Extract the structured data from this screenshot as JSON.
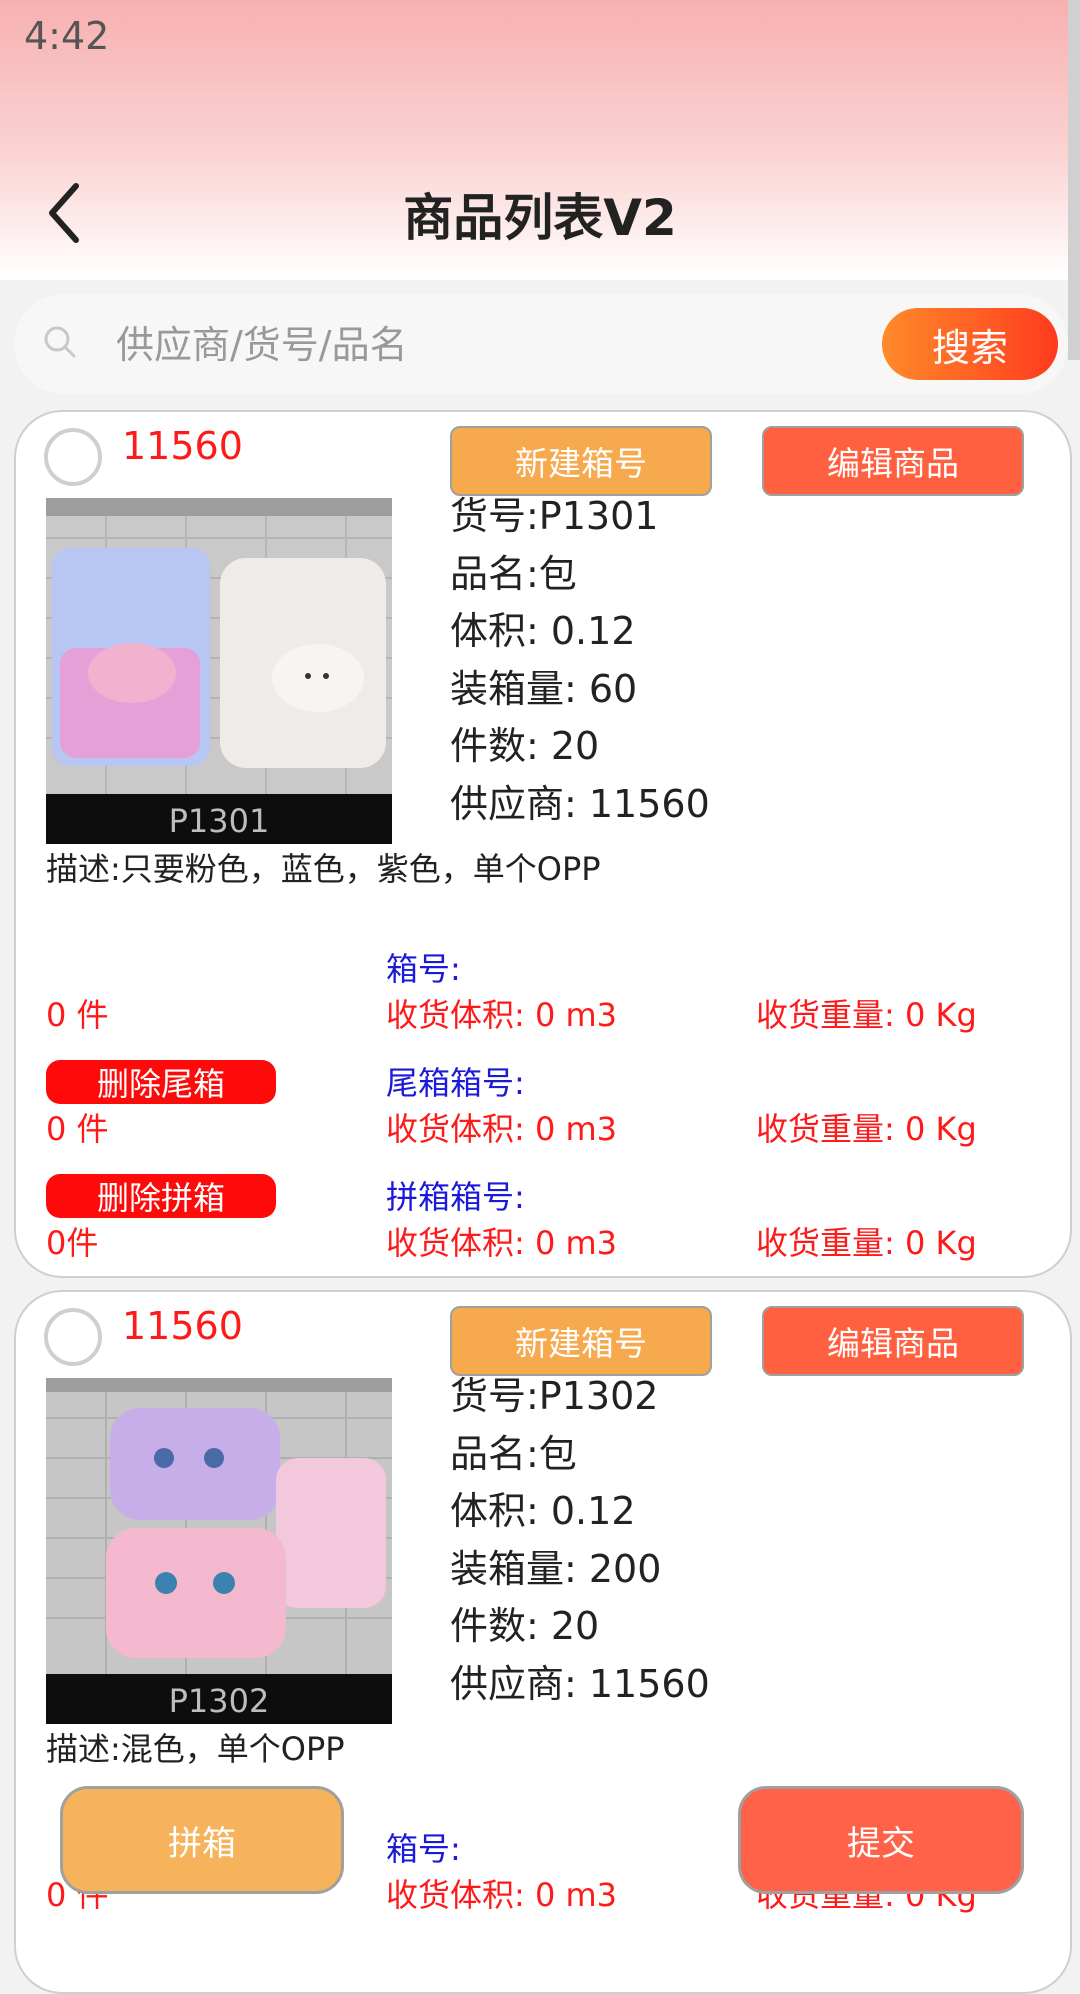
{
  "status_bar": {
    "time": "4:42"
  },
  "header": {
    "title": "商品列表V2"
  },
  "search": {
    "placeholder": "供应商/货号/品名",
    "button_label": "搜索"
  },
  "products": [
    {
      "supplier_id": "11560",
      "new_box_label": "新建箱号",
      "edit_label": "编辑商品",
      "image_caption": "P1301",
      "sku": "货号:P1301",
      "name": "品名:包",
      "volume": "体积: 0.12",
      "pack_qty": "装箱量: 60",
      "pieces": "件数: 20",
      "supplier": "供应商: 11560",
      "description": "描述:只要粉色，蓝色，紫色，单个OPP",
      "box_no_label": "箱号:",
      "box_qty": "0 件",
      "box_volume": "收货体积: 0 m3",
      "box_weight": "收货重量: 0 Kg",
      "delete_tail_label": "删除尾箱",
      "tail_box_label": "尾箱箱号:",
      "tail_qty": "0 件",
      "tail_volume": "收货体积: 0 m3",
      "tail_weight": "收货重量: 0 Kg",
      "delete_combined_label": "删除拼箱",
      "combined_box_label": "拼箱箱号:",
      "combined_qty": "0件",
      "combined_volume": "收货体积: 0 m3",
      "combined_weight": "收货重量: 0 Kg"
    },
    {
      "supplier_id": "11560",
      "new_box_label": "新建箱号",
      "edit_label": "编辑商品",
      "image_caption": "P1302",
      "sku": "货号:P1302",
      "name": "品名:包",
      "volume": "体积: 0.12",
      "pack_qty": "装箱量: 200",
      "pieces": "件数: 20",
      "supplier": "供应商: 11560",
      "description": "描述:混色，单个OPP",
      "box_no_label": "箱号:",
      "box_qty": "0 件",
      "box_volume": "收货体积: 0 m3",
      "box_weight": "收货重量: 0 Kg"
    }
  ],
  "footer": {
    "combine_label": "拼箱",
    "submit_label": "提交"
  },
  "colors": {
    "accent": "#ff3b1f",
    "orange": "#f7a94d",
    "red_text": "#ff1a1a",
    "blue_text": "#1a1ad8"
  }
}
